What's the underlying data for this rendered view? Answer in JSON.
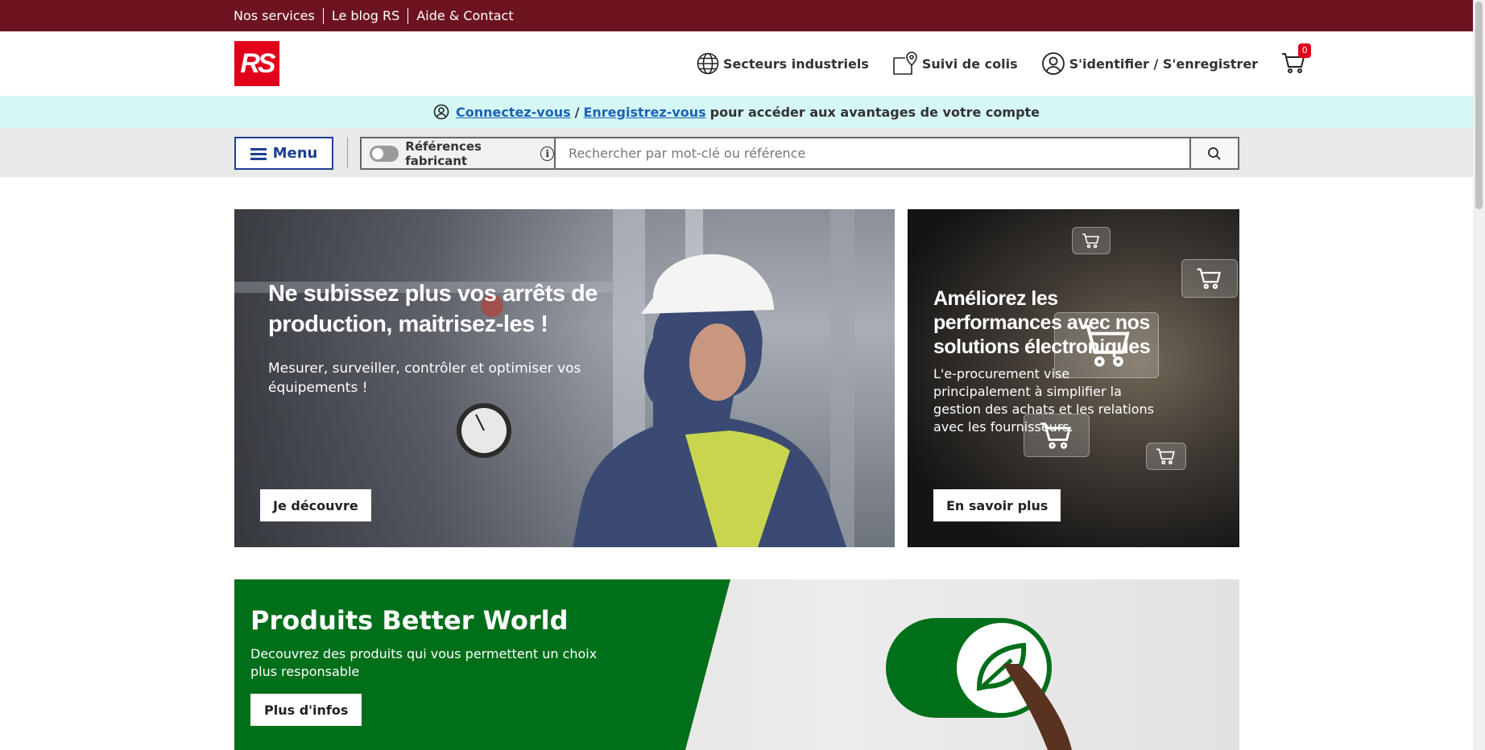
{
  "utility_bar": {
    "links": [
      "Nos services",
      "Le blog RS",
      "Aide & Contact"
    ]
  },
  "header": {
    "logo_text": "RS",
    "nav": {
      "sectors": "Secteurs industriels",
      "tracking": "Suivi de colis",
      "account": "S'identifier / S'enregistrer"
    },
    "cart_count": "0"
  },
  "account_banner": {
    "login_link": "Connectez-vous",
    "separator": "/",
    "register_link": "Enregistrez-vous",
    "text": "pour accéder aux avantages de votre compte"
  },
  "search": {
    "menu_label": "Menu",
    "toggle_label": "Références fabricant",
    "toggle_on": false,
    "placeholder": "Rechercher par mot-clé ou référence"
  },
  "hero_left": {
    "title": "Ne subissez plus vos arrêts de production, maitrisez-les !",
    "subtitle": "Mesurer, surveiller, contrôler et optimiser vos équipements !",
    "button": "Je découvre"
  },
  "hero_right": {
    "title": "Améliorez les performances avec nos solutions électroniques",
    "subtitle": "L'e-procurement vise principalement à simplifier la gestion des achats et les relations avec les fournisseurs.",
    "button": "En savoir plus"
  },
  "better_world": {
    "title": "Produits Better World",
    "subtitle": "Decouvrez des produits qui vous permettent un choix plus responsable",
    "button": "Plus d'infos"
  },
  "colors": {
    "utility_bar": "#6d1320",
    "brand_red": "#e2001a",
    "link_blue": "#1a63b5",
    "menu_blue": "#1d3f8f",
    "banner_cyan": "#d5f7f6",
    "better_world_green": "#006f1a"
  }
}
